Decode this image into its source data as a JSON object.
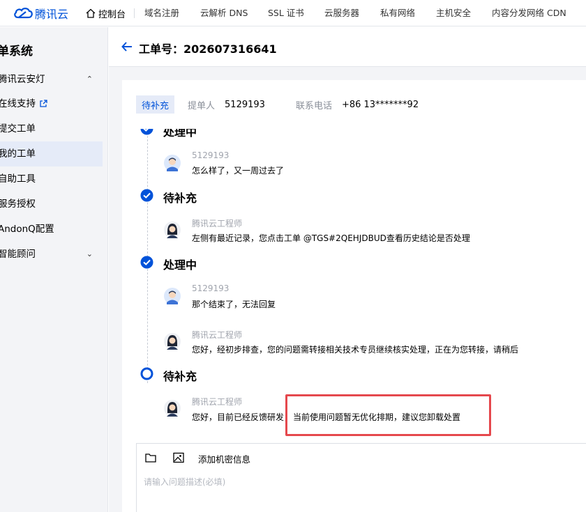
{
  "nav": {
    "brand": "腾讯云",
    "console": "控制台",
    "links": [
      "域名注册",
      "云解析 DNS",
      "SSL 证书",
      "云服务器",
      "私有网络",
      "主机安全",
      "内容分发网络 CDN"
    ]
  },
  "sidebar": {
    "title": "单系统",
    "items": [
      {
        "label": "腾讯云安灯",
        "chevron": "up"
      },
      {
        "label": "在线支持",
        "icon": "external-link-icon"
      },
      {
        "label": "提交工单"
      },
      {
        "label": "我的工单",
        "active": true
      },
      {
        "label": "自助工具"
      },
      {
        "label": "服务授权"
      },
      {
        "label": "AndonQ配置"
      },
      {
        "label": "智能顾问",
        "chevron": "down"
      }
    ]
  },
  "header": {
    "title": "工单号：202607316641"
  },
  "info": {
    "status_badge": "待补充",
    "submitter_label": "提单人",
    "submitter_value": "5129193",
    "phone_label": "联系电话",
    "phone_value": "+86 13*******92"
  },
  "timeline": {
    "partial_status": "处理中",
    "groups": [
      {
        "status": "待补充",
        "icon": "check-circle-icon"
      },
      {
        "status": "处理中",
        "icon": "check-circle-icon"
      },
      {
        "status": "待补充",
        "icon": "current-circle-icon"
      }
    ],
    "messages": [
      {
        "author": "5129193",
        "text": "怎么样了，又一周过去了"
      },
      {
        "author": "腾讯云工程师",
        "text": "左侧有最近记录，您点击工单 @TGS#2QEHJDBUD查看历史结论是否处理"
      },
      {
        "author": "5129193",
        "text": "那个结束了，无法回复"
      },
      {
        "author": "腾讯云工程师",
        "text": "您好，经初步排查，您的问题需转接相关技术专员继续核实处理，正在为您转接，请稍后"
      },
      {
        "author": "腾讯云工程师",
        "text": "您好，目前已经反馈研发，",
        "highlight_text": "当前使用问题暂无优化排期，建议您卸载处置"
      }
    ]
  },
  "editor": {
    "add_secret_label": "添加机密信息",
    "placeholder": "请输入问题描述(必填)"
  },
  "colors": {
    "brand": "#0052d9",
    "highlight_border": "#e5484d",
    "sidebar_bg": "#f3f4f7",
    "active_bg": "#e5ebf8"
  }
}
